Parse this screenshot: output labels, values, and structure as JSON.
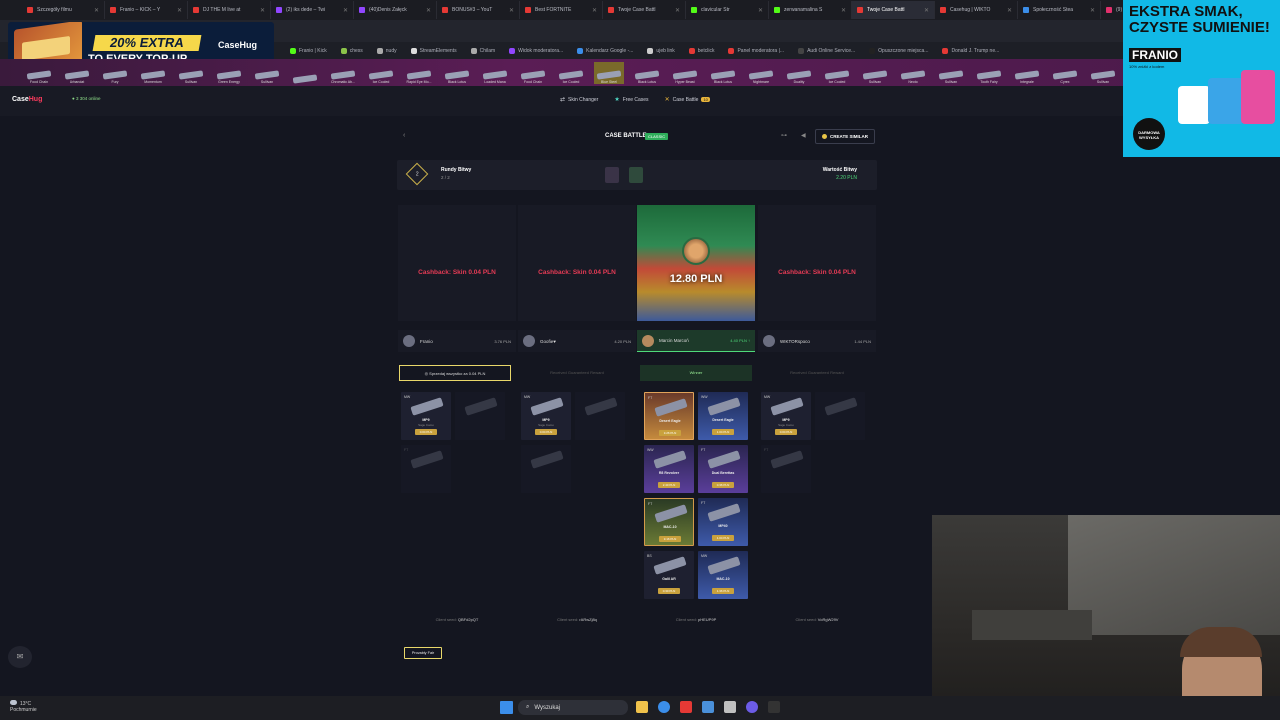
{
  "browser": {
    "tabs": [
      {
        "label": "Szczegóły filmu",
        "color": "#e53935"
      },
      {
        "label": "Franio – KICK – Y",
        "color": "#e53935"
      },
      {
        "label": "DJ THE M live at",
        "color": "#e53935"
      },
      {
        "label": "(2) iks dede – Twi",
        "color": "#9146ff"
      },
      {
        "label": "(40)Denis Załęck",
        "color": "#9146ff"
      },
      {
        "label": "BONUS#3 – YouT",
        "color": "#e53935"
      },
      {
        "label": "Best FORTNITE",
        "color": "#e53935"
      },
      {
        "label": "Twoje Case Battl",
        "color": "#e53935"
      },
      {
        "label": "clavicular Str",
        "color": "#53fc18"
      },
      {
        "label": "zerwanamalina S",
        "color": "#53fc18"
      },
      {
        "label": "Twoje Case Battl",
        "color": "#e53935",
        "active": true
      },
      {
        "label": "Casehug | WIKTO",
        "color": "#e53935"
      },
      {
        "label": "Społeczność Stea",
        "color": "#3b8eea"
      },
      {
        "label": "(9) Inst",
        "color": "#e1306c"
      }
    ],
    "bookmarks": [
      {
        "label": "Franio | Kick",
        "color": "#53fc18"
      },
      {
        "label": "chess",
        "color": "#8bc34a"
      },
      {
        "label": "nudy",
        "color": "#aaaaaa"
      },
      {
        "label": "StreamElements",
        "color": "#dddddd"
      },
      {
        "label": "Chilam",
        "color": "#aaaaaa"
      },
      {
        "label": "Widok moderatora...",
        "color": "#9146ff"
      },
      {
        "label": "Kalendarz Google -...",
        "color": "#3b8eea"
      },
      {
        "label": "ujeb link",
        "color": "#cccccc"
      },
      {
        "label": "betclick",
        "color": "#e53935"
      },
      {
        "label": "Panel moderatora |...",
        "color": "#e53935"
      },
      {
        "label": "Audi Online Service...",
        "color": "#444444"
      },
      {
        "label": "Opuszczone miejsca...",
        "color": "#222222"
      },
      {
        "label": "Donald J. Trump ne...",
        "color": "#e53935"
      }
    ]
  },
  "promo": {
    "percent": "20% EXTRA",
    "text": "TO EVERY TOP-UP",
    "brand": "CaseHug"
  },
  "ticker": {
    "items": [
      "Food Chain",
      "Urbandat",
      "Fury",
      "Momentum",
      "Sullivan",
      "Green Energy",
      "Sullivan",
      "",
      "Chromatic Ab...",
      "Ice Cooled",
      "Rapid Eye Mo...",
      "Black Lotus",
      "Loaded Mana",
      "Food Chain",
      "Ice Cooled",
      "Blue Steel",
      "Black Lotus",
      "Hyper Beast",
      "Black Lotus",
      "Nightmare",
      "Duality",
      "Ice Cooled",
      "Sullivan",
      "Neoto",
      "Sullivan",
      "Tooth Fairy",
      "Integrale",
      "Cyrex",
      "Sullivan",
      "Sullivan",
      "Phantom Dis...",
      "Wonder Wea...",
      "Fancy Kot"
    ]
  },
  "site": {
    "logo_a": "Case",
    "logo_b": "Hug",
    "online": "● 3 304\nonline",
    "nav": [
      {
        "icon": "⇄",
        "label": "Skin Changer"
      },
      {
        "icon": "★",
        "label": "Free Cases"
      },
      {
        "icon": "✕",
        "label": "Case Battle",
        "badge": "10"
      }
    ]
  },
  "battle": {
    "title": "CASE BATTLE",
    "mode": "CLASSIC",
    "create_similar": "CREATE SIMILAR",
    "round_num": "2",
    "rounds_label": "Rundy Bitwy",
    "rounds_value": "2 / 2",
    "value_label": "Wartość Bitwy",
    "value_amount": "2.20 PLN",
    "cashback_text": "Cashback: Skin 0.04 PLN",
    "winner_amount": "12.80 PLN",
    "players": [
      {
        "name": "Franio",
        "value": "3.76 PLN"
      },
      {
        "name": "Goofie♥",
        "value": "4.20 PLN"
      },
      {
        "name": "Marcin Marcoń",
        "value": "4.40 PLN ↑"
      },
      {
        "name": "WIKTORspoco",
        "value": "1.44 PLN"
      }
    ],
    "statuses": [
      "◎ Sprzedaj wszystko za 0.04 PLN",
      "Received Guaranteed Reward",
      "Winner",
      "Received Guaranteed Reward"
    ],
    "seeds": [
      {
        "label": "Client seed:",
        "value": "QBFd2pQT"
      },
      {
        "label": "Client seed:",
        "value": "rARwZj8q"
      },
      {
        "label": "Client seed:",
        "value": "pHEUP9P"
      },
      {
        "label": "Client seed:",
        "value": "VoRgW29V"
      }
    ],
    "fair_button": "Provably Fair"
  },
  "items": {
    "col1": [
      {
        "q": "MW",
        "name": "MP9",
        "skin": "Sage Camo",
        "price": "0.04 PLN"
      },
      {
        "q": "",
        "name": "",
        "skin": "",
        "price": ""
      },
      {
        "q": "FT",
        "name": "",
        "skin": "",
        "price": ""
      }
    ],
    "col2": [
      {
        "q": "MW",
        "name": "MP9",
        "skin": "Sage Camo",
        "price": "0.04 PLN"
      },
      {
        "q": "",
        "name": "",
        "skin": "",
        "price": ""
      },
      {
        "q": "",
        "name": "",
        "skin": "",
        "price": ""
      }
    ],
    "col3": [
      {
        "q": "FT",
        "name": "Desert Eagle",
        "skin": "",
        "price": "3.26 PLN"
      },
      {
        "q": "WW",
        "name": "Desert Eagle",
        "skin": "",
        "price": "1.04 PLN"
      },
      {
        "q": "WW",
        "name": "R8 Revolver",
        "skin": "",
        "price": "2.40 PLN"
      },
      {
        "q": "FT",
        "name": "Dual Berettas",
        "skin": "",
        "price": "0.36 PLN"
      },
      {
        "q": "FT",
        "name": "MAC-10",
        "skin": "",
        "price": "3.16 PLN"
      },
      {
        "q": "FT",
        "name": "MP40",
        "skin": "",
        "price": "1.04 PLN"
      },
      {
        "q": "BS",
        "name": "Galil AR",
        "skin": "",
        "price": "0.30 PLN"
      },
      {
        "q": "MW",
        "name": "MAC-10",
        "skin": "",
        "price": "1.36 PLN"
      }
    ],
    "col4": [
      {
        "q": "MW",
        "name": "MP9",
        "skin": "Sage Camo",
        "price": "0.04 PLN"
      },
      {
        "q": "",
        "name": "",
        "skin": "",
        "price": ""
      },
      {
        "q": "FT",
        "name": "",
        "skin": "",
        "price": ""
      }
    ]
  },
  "ad": {
    "headline": "EKSTRA SMAK,\nCZYSTE SUMIENIE!",
    "brand": "FRANIO",
    "sub": "10% zniżki z kodem",
    "stamp": "DARMOWA WYSYŁKA"
  },
  "taskbar": {
    "temp": "13°C",
    "weather": "Pochmurnie",
    "search_placeholder": "Wyszukaj"
  }
}
